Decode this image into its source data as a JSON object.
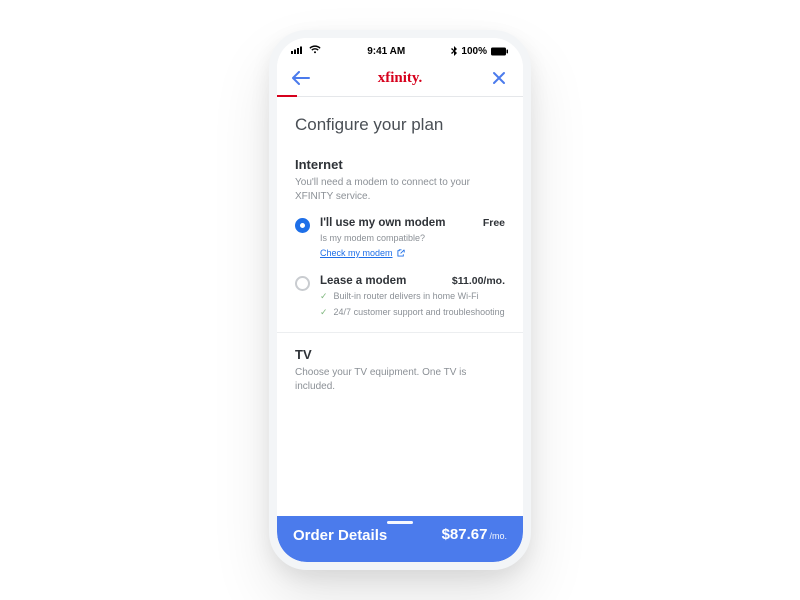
{
  "status": {
    "time": "9:41 AM",
    "battery": "100%"
  },
  "nav": {
    "brand": "xfinity."
  },
  "page": {
    "title": "Configure your plan"
  },
  "internet": {
    "title": "Internet",
    "subtitle": "You'll need a modem to connect to your XFINITY service.",
    "options": [
      {
        "label": "I'll use my own modem",
        "price": "Free",
        "help": "Is my modem compatible?",
        "link": "Check my modem",
        "selected": true
      },
      {
        "label": "Lease a modem",
        "price": "$11.00/mo.",
        "features": [
          "Built-in router delivers in home Wi-Fi",
          "24/7 customer support and troubleshooting"
        ],
        "selected": false
      }
    ]
  },
  "tv": {
    "title": "TV",
    "subtitle": "Choose your TV equipment. One TV is included."
  },
  "order": {
    "title": "Order Details",
    "price": "$87.67",
    "per": "/mo."
  }
}
